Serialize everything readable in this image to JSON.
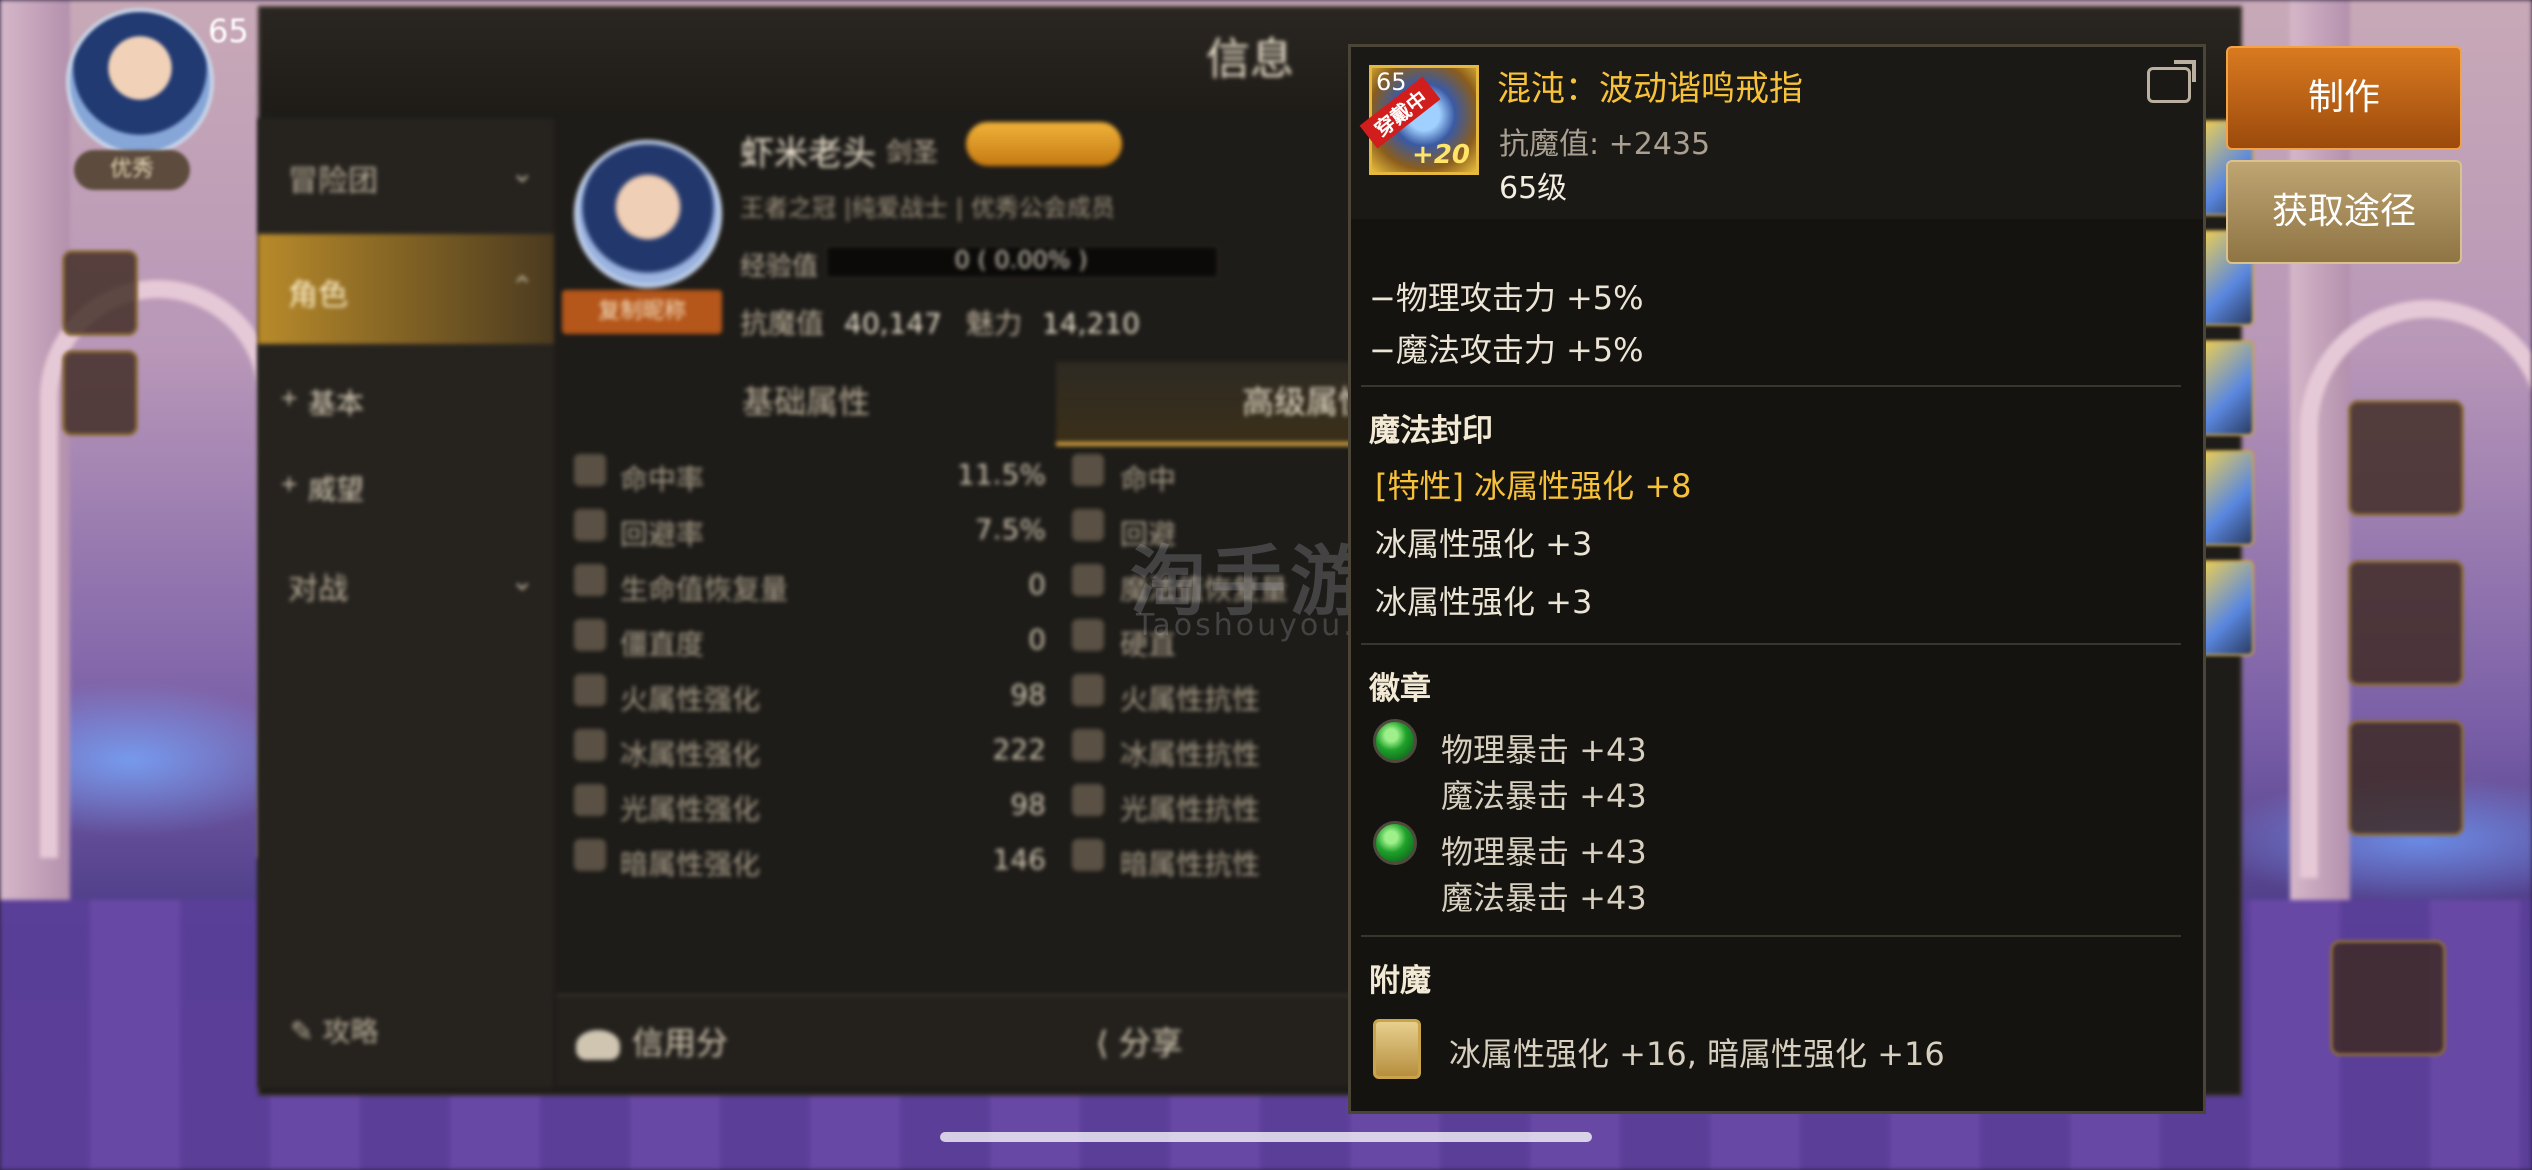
{
  "top_hud": {
    "level": "65",
    "pill_label": "优秀"
  },
  "window": {
    "title": "信息",
    "sidebar": [
      {
        "label": "冒险团",
        "chevron": "chevron-down-icon"
      },
      {
        "label": "角色",
        "chevron": "chevron-up-icon",
        "active": true
      },
      {
        "label": "基本",
        "sub": true
      },
      {
        "label": "威望",
        "sub": true
      },
      {
        "label": "对战",
        "chevron": "chevron-down-icon"
      }
    ],
    "guide_label": "攻略",
    "profile": {
      "name": "虾米老头",
      "class": "剑圣",
      "subtitle": "王者之冠 |纯爱战士 | 优秀公会成员",
      "copy_button": "复制昵称",
      "exp_label": "经验值",
      "exp_value": "0 ( 0.00% )",
      "resist_label": "抗魔值",
      "resist_value": "40,147",
      "charm_label": "魅力",
      "charm_value": "14,210"
    },
    "tabs": [
      {
        "label": "基础属性"
      },
      {
        "label": "高级属性",
        "active": true
      }
    ],
    "stats": [
      {
        "name": "命中率",
        "value": "11.5%",
        "name2": "命中"
      },
      {
        "name": "回避率",
        "value": "7.5%",
        "name2": "回避"
      },
      {
        "name": "生命值恢复量",
        "value": "0",
        "name2": "魔法值恢复量"
      },
      {
        "name": "僵直度",
        "value": "0",
        "name2": "硬直"
      },
      {
        "name": "火属性强化",
        "value": "98",
        "name2": "火属性抗性"
      },
      {
        "name": "冰属性强化",
        "value": "222",
        "name2": "冰属性抗性"
      },
      {
        "name": "光属性强化",
        "value": "98",
        "name2": "光属性抗性"
      },
      {
        "name": "暗属性强化",
        "value": "146",
        "name2": "暗属性抗性"
      }
    ],
    "bottom": {
      "credit_label": "信用分",
      "share_label": "分享"
    }
  },
  "watermark": {
    "line1": "淘手游",
    "line2": "Taoshouyou.Com"
  },
  "tooltip": {
    "icon": {
      "level_text": "65",
      "ribbon": "穿戴中",
      "enhance": "+20"
    },
    "name": "混沌：波动谐鸣戒指",
    "resist": "抗魔值:  +2435",
    "level": "65级",
    "lines": [
      "−物理攻击力 +5%",
      "−魔法攻击力 +5%"
    ],
    "seal": {
      "title": "魔法封印",
      "trait": "[特性] 冰属性强化 +8",
      "items": [
        "冰属性强化 +3",
        "冰属性强化 +3"
      ]
    },
    "emblem": {
      "title": "徽章",
      "gems": [
        {
          "line1": "物理暴击 +43",
          "line2": "魔法暴击 +43"
        },
        {
          "line1": "物理暴击 +43",
          "line2": "魔法暴击 +43"
        }
      ]
    },
    "enchant": {
      "title": "附魔",
      "text": "冰属性强化 +16, 暗属性强化 +16"
    }
  },
  "buttons": {
    "craft": "制作",
    "source": "获取途径"
  },
  "colors": {
    "gold": "#f7c23a",
    "craft_button": "#c9661a",
    "source_button": "#a88c57"
  }
}
